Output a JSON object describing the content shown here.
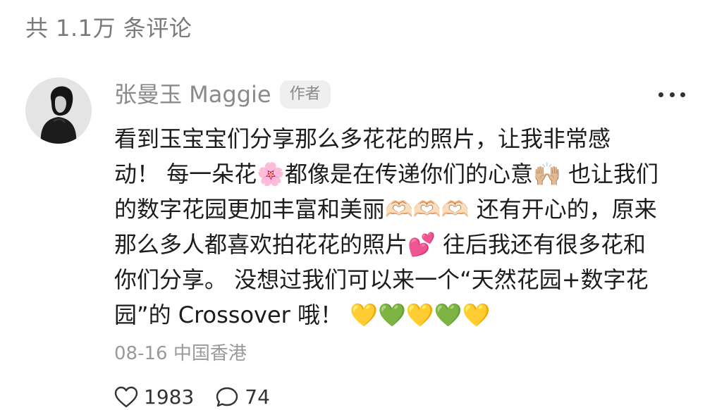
{
  "comments_header": {
    "count_label": "共 1.1万 条评论"
  },
  "comment": {
    "author": {
      "name": "张曼玉 Maggie",
      "badge": "作者"
    },
    "body_lines": [
      "看到玉宝宝们分享那么多花花的照片，让我非常感",
      "动！ 每一朵花🌸都像是在传递你们的心意🙌🏼 也让我们",
      "的数字花园更加丰富和美丽🫶🏻🫶🏻🫶🏻 还有开心的，原来",
      "那么多人都喜欢拍花花的照片💕 往后我还有很多花和",
      "你们分享。 没想过我们可以来一个“天然花园+数字花",
      "园”的 Crossover 哦！ 💛💚💛💚💛"
    ],
    "meta": "08-16 中国香港",
    "likes": "1983",
    "replies": "74"
  },
  "colors": {
    "secondary_text": "#8a8a8a",
    "primary_text": "#1c1c1c",
    "badge_bg": "#efefef"
  },
  "icons": {
    "more": "more-dots-icon",
    "like": "heart-outline-icon",
    "reply": "speech-bubble-icon"
  }
}
